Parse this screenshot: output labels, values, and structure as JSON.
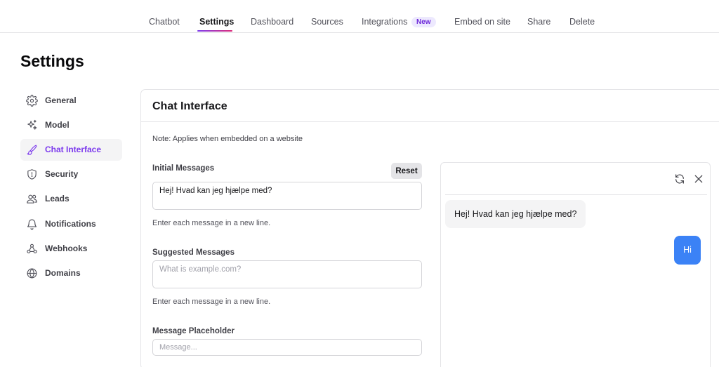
{
  "topnav": {
    "tabs": [
      {
        "label": "Chatbot",
        "active": false
      },
      {
        "label": "Settings",
        "active": true
      },
      {
        "label": "Dashboard",
        "active": false
      },
      {
        "label": "Sources",
        "active": false
      },
      {
        "label": "Integrations",
        "active": false,
        "badge": "New"
      },
      {
        "label": "Embed on site",
        "active": false
      },
      {
        "label": "Share",
        "active": false
      },
      {
        "label": "Delete",
        "active": false
      }
    ]
  },
  "page": {
    "title": "Settings"
  },
  "sidebar": {
    "items": [
      {
        "label": "General",
        "icon": "gear-icon",
        "active": false
      },
      {
        "label": "Model",
        "icon": "sparkles-icon",
        "active": false
      },
      {
        "label": "Chat Interface",
        "icon": "brush-icon",
        "active": true
      },
      {
        "label": "Security",
        "icon": "shield-icon",
        "active": false
      },
      {
        "label": "Leads",
        "icon": "users-icon",
        "active": false
      },
      {
        "label": "Notifications",
        "icon": "bell-icon",
        "active": false
      },
      {
        "label": "Webhooks",
        "icon": "webhook-icon",
        "active": false
      },
      {
        "label": "Domains",
        "icon": "globe-icon",
        "active": false
      }
    ]
  },
  "panel": {
    "title": "Chat Interface",
    "note": "Note: Applies when embedded on a website",
    "initial_messages": {
      "label": "Initial Messages",
      "reset_label": "Reset",
      "value": "Hej! Hvad kan jeg hjælpe med?",
      "hint": "Enter each message in a new line."
    },
    "suggested_messages": {
      "label": "Suggested Messages",
      "placeholder": "What is example.com?",
      "hint": "Enter each message in a new line."
    },
    "message_placeholder": {
      "label": "Message Placeholder",
      "placeholder": "Message..."
    }
  },
  "preview": {
    "bot_message": "Hej! Hvad kan jeg hjælpe med?",
    "user_message": "Hi",
    "colors": {
      "user_bubble": "#3b82f6",
      "bot_bubble": "#f4f4f5",
      "accent": "#7c3aed"
    }
  }
}
